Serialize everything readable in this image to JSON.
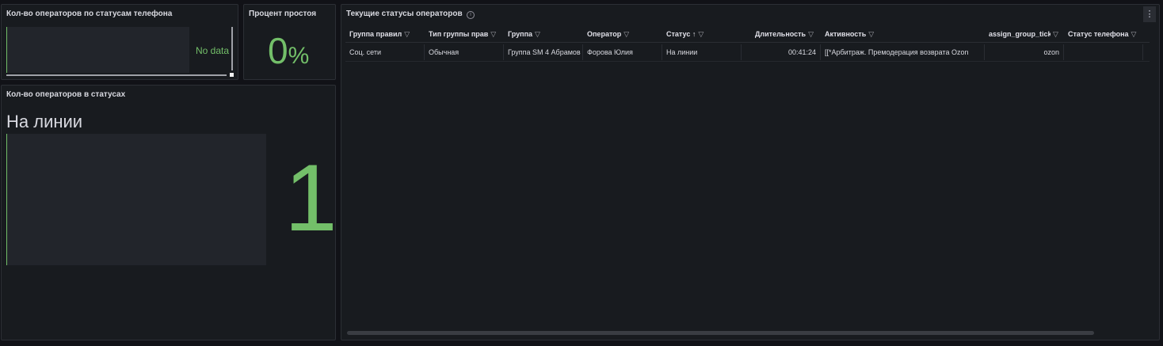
{
  "panels": {
    "phone_status": {
      "title": "Кол-во операторов по статусам телефона",
      "no_data": "No data"
    },
    "idle_percent": {
      "title": "Процент простоя",
      "value": "0",
      "unit": "%"
    },
    "status_count": {
      "title": "Кол-во операторов в статусах",
      "status": "На линии",
      "count": "1"
    },
    "operators_table": {
      "title": "Текущие статусы операторов",
      "info_icon": "i",
      "menu_icon": "⋮",
      "columns": [
        "Группа правил",
        "Тип группы прав",
        "Группа",
        "Оператор",
        "Статус",
        "Длительность",
        "Активность",
        "assign_group_tick",
        "Статус телефона"
      ],
      "sort_column": "Статус",
      "sort_icon": "↑",
      "rows": [
        {
          "c0": "Соц. сети",
          "c1": "Обычная",
          "c2": "Группа SM 4 Абрамов",
          "c3": "Форова Юлия",
          "c4": "На линии",
          "c5": "00:41:24",
          "c6": "[[*Арбитраж. Премодерация возврата Ozon",
          "c7": "ozon",
          "c8": ""
        }
      ]
    }
  },
  "colors": {
    "background": "#111217",
    "panel": "#181b1f",
    "accent_green": "#73bf69"
  }
}
